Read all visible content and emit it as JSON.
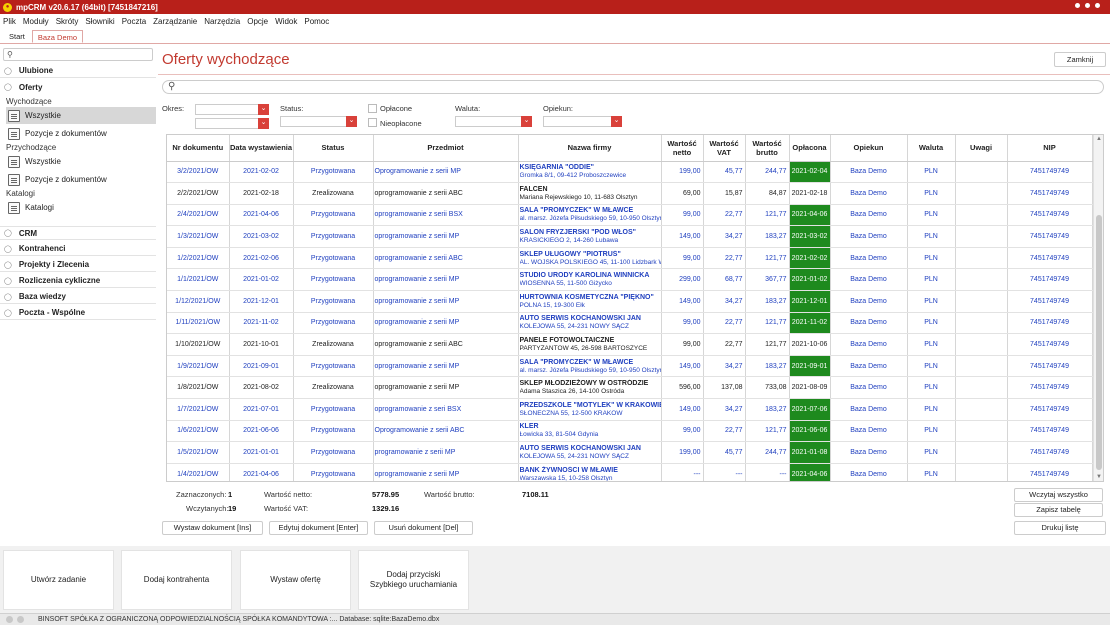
{
  "window": {
    "title": "mpCRM v20.6.17 (64bit) [7451847216]"
  },
  "menu": [
    "Plik",
    "Moduły",
    "Skróty",
    "Słowniki",
    "Poczta",
    "Zarządzanie",
    "Narzędzia",
    "Opcje",
    "Widok",
    "Pomoc"
  ],
  "tabs": [
    {
      "label": "Start"
    },
    {
      "label": "Baza Demo"
    }
  ],
  "sidebar": {
    "ulubione": "Ulubione",
    "oferty": "Oferty",
    "wychodzace": "Wychodzące",
    "wszystkie": "Wszystkie",
    "pozycje": "Pozycje z dokumentów",
    "przychodzace": "Przychodzące",
    "katalogi": "Katalogi",
    "sections": [
      "CRM",
      "Kontrahenci",
      "Projekty i Zlecenia",
      "Rozliczenia cykliczne",
      "Baza wiedzy",
      "Poczta - Wspólne"
    ]
  },
  "main": {
    "title": "Oferty wychodzące",
    "close_label": "Zamknij",
    "filters": {
      "okres": "Okres:",
      "status": "Status:",
      "oplacone": "Opłacone",
      "nieoplacone": "Nieopłacone",
      "waluta": "Waluta:",
      "opiekun": "Opiekun:"
    },
    "columns": [
      "Nr dokumentu",
      "Data wystawienia",
      "Status",
      "Przedmiot",
      "Nazwa firmy",
      "Wartość netto",
      "Wartość VAT",
      "Wartość brutto",
      "Opłacona",
      "Opiekun",
      "Waluta",
      "Uwagi",
      "NIP"
    ],
    "rows": [
      {
        "nr": "3/2/2021/OW",
        "data": "2021-02-02",
        "status": "Przygotowana",
        "przedmiot": "Oprogramowanie z serii MP",
        "firma": "KSIĘGARNIA \"ODDIE\"",
        "adres": "Gromka 8/1, 09-412 Proboszczewice",
        "netto": "199,00",
        "vat": "45,77",
        "brutto": "244,77",
        "oplacona": "2021-02-04",
        "opiekun": "Baza Demo",
        "waluta": "PLN",
        "uwagi": "",
        "nip": "7451749749"
      },
      {
        "nr": "2/2/2021/OW",
        "data": "2021-02-18",
        "status": "Zrealizowana",
        "przedmiot": "oprogramowanie z serii ABC",
        "firma": "FALCEN",
        "adres": "Mariana Rejewskiego 10, 11-683 Olsztyn",
        "netto": "69,00",
        "vat": "15,87",
        "brutto": "84,87",
        "oplacona": "2021-02-18",
        "opiekun": "Baza Demo",
        "waluta": "PLN",
        "uwagi": "",
        "nip": "7451749749"
      },
      {
        "nr": "2/4/2021/OW",
        "data": "2021-04-06",
        "status": "Przygotowana",
        "przedmiot": "oprogramowanie z serii BSX",
        "firma": "SALA \"PROMYCZEK\" W MŁAWCE",
        "adres": "al. marsz. Józefa Piłsudskiego 59, 10-950 Olsztyn",
        "netto": "99,00",
        "vat": "22,77",
        "brutto": "121,77",
        "oplacona": "2021-04-06",
        "opiekun": "Baza Demo",
        "waluta": "PLN",
        "uwagi": "",
        "nip": "7451749749"
      },
      {
        "nr": "1/3/2021/OW",
        "data": "2021-03-02",
        "status": "Przygotowana",
        "przedmiot": "oprogramowanie z serii MP",
        "firma": "SALON FRYZJERSKI \"POD WŁOS\"",
        "adres": "KRASICKIEGO 2, 14-260 Lubawa",
        "netto": "149,00",
        "vat": "34,27",
        "brutto": "183,27",
        "oplacona": "2021-03-02",
        "opiekun": "Baza Demo",
        "waluta": "PLN",
        "uwagi": "",
        "nip": "7451749749"
      },
      {
        "nr": "1/2/2021/OW",
        "data": "2021-02-06",
        "status": "Przygotowana",
        "przedmiot": "oprogramowanie z serii ABC",
        "firma": "SKLEP UŁUGOWY \"PIOTRUŚ\"",
        "adres": "AL. WOJSKA POLSKIEGO 45, 11-100 Lidzbark Warmiński",
        "netto": "99,00",
        "vat": "22,77",
        "brutto": "121,77",
        "oplacona": "2021-02-02",
        "opiekun": "Baza Demo",
        "waluta": "PLN",
        "uwagi": "",
        "nip": "7451749749"
      },
      {
        "nr": "1/1/2021/OW",
        "data": "2021-01-02",
        "status": "Przygotowana",
        "przedmiot": "oprogramowanie  z serii MP",
        "firma": "STUDIO URODY KAROLINA WINNICKA",
        "adres": "WIOSENNA 55, 11-500 Giżycko",
        "netto": "299,00",
        "vat": "68,77",
        "brutto": "367,77",
        "oplacona": "2021-01-02",
        "opiekun": "Baza Demo",
        "waluta": "PLN",
        "uwagi": "",
        "nip": "7451749749"
      },
      {
        "nr": "1/12/2021/OW",
        "data": "2021-12-01",
        "status": "Przygotowana",
        "przedmiot": "oprogramowanie z serii MP",
        "firma": "HURTOWNIA KOSMETYCZNA \"PIĘKNO\"",
        "adres": "POLNA 15, 19-300 Ełk",
        "netto": "149,00",
        "vat": "34,27",
        "brutto": "183,27",
        "oplacona": "2021-12-01",
        "opiekun": "Baza Demo",
        "waluta": "PLN",
        "uwagi": "",
        "nip": "7451749749"
      },
      {
        "nr": "1/11/2021/OW",
        "data": "2021-11-02",
        "status": "Przygotowana",
        "przedmiot": "oprogramowanie z serii MP",
        "firma": "AUTO SERWIS KOCHANOWSKI JAN",
        "adres": "KOLEJOWA 55, 24-231 NOWY SĄCZ",
        "netto": "99,00",
        "vat": "22,77",
        "brutto": "121,77",
        "oplacona": "2021-11-02",
        "opiekun": "Baza Demo",
        "waluta": "PLN",
        "uwagi": "",
        "nip": "7451749749"
      },
      {
        "nr": "1/10/2021/OW",
        "data": "2021-10-01",
        "status": "Zrealizowana",
        "przedmiot": "oprogramowanie z serii ABC",
        "firma": "PANELE FOTOWOLTAICZNE",
        "adres": "PARTYZANTÓW 45, 26-598 BARTOSZYCE",
        "netto": "99,00",
        "vat": "22,77",
        "brutto": "121,77",
        "oplacona": "2021-10-06",
        "opiekun": "Baza Demo",
        "waluta": "PLN",
        "uwagi": "",
        "nip": "7451749749"
      },
      {
        "nr": "1/9/2021/OW",
        "data": "2021-09-01",
        "status": "Przygotowana",
        "przedmiot": "oprogramowanie z serii MP",
        "firma": "SALA \"PROMYCZEK\" W MŁAWCE",
        "adres": "al. marsz. Józefa Piłsudskiego 59, 10-950 Olsztyn",
        "netto": "149,00",
        "vat": "34,27",
        "brutto": "183,27",
        "oplacona": "2021-09-01",
        "opiekun": "Baza Demo",
        "waluta": "PLN",
        "uwagi": "",
        "nip": "7451749749"
      },
      {
        "nr": "1/8/2021/OW",
        "data": "2021-08-02",
        "status": "Zrealizowana",
        "przedmiot": "oprogramowanie z serii MP",
        "firma": "SKLEP MŁODZIEŻOWY W OSTRÓDZIE",
        "adres": "Adama Staszica 26, 14-100 Ostróda",
        "netto": "596,00",
        "vat": "137,08",
        "brutto": "733,08",
        "oplacona": "2021-08-09",
        "opiekun": "Baza Demo",
        "waluta": "PLN",
        "uwagi": "",
        "nip": "7451749749"
      },
      {
        "nr": "1/7/2021/OW",
        "data": "2021-07-01",
        "status": "Przygotowana",
        "przedmiot": "oprogramowanie z seri BSX",
        "firma": "PRZEDSZKOLE \"MOTYLEK\" W KRAKOWIE",
        "adres": "SŁONECZNA 55, 12-500 KRAKÓW",
        "netto": "149,00",
        "vat": "34,27",
        "brutto": "183,27",
        "oplacona": "2021-07-06",
        "opiekun": "Baza Demo",
        "waluta": "PLN",
        "uwagi": "",
        "nip": "7451749749"
      },
      {
        "nr": "1/6/2021/OW",
        "data": "2021-06-06",
        "status": "Przygotowana",
        "przedmiot": "Oprogramowanie z serii ABC",
        "firma": "KLER",
        "adres": "Łowicka 33, 81-504 Gdynia",
        "netto": "99,00",
        "vat": "22,77",
        "brutto": "121,77",
        "oplacona": "2021-06-06",
        "opiekun": "Baza Demo",
        "waluta": "PLN",
        "uwagi": "",
        "nip": "7451749749"
      },
      {
        "nr": "1/5/2021/OW",
        "data": "2021-01-01",
        "status": "Przygotowana",
        "przedmiot": "programowanie z serii MP",
        "firma": "AUTO SERWIS KOCHANOWSKI JAN",
        "adres": "KOLEJOWA 55, 24-231 NOWY SĄCZ",
        "netto": "199,00",
        "vat": "45,77",
        "brutto": "244,77",
        "oplacona": "2021-01-08",
        "opiekun": "Baza Demo",
        "waluta": "PLN",
        "uwagi": "",
        "nip": "7451749749"
      },
      {
        "nr": "1/4/2021/OW",
        "data": "2021-04-06",
        "status": "Przygotowana",
        "przedmiot": "oprogramowanie z serii MP",
        "firma": "BANK ŻYWNOŚCI W MŁAWIE",
        "adres": "Warszawska 15, 10-258 Olsztyn",
        "netto": "---",
        "vat": "---",
        "brutto": "---",
        "oplacona": "2021-04-06",
        "opiekun": "Baza Demo",
        "waluta": "PLN",
        "uwagi": "",
        "nip": "7451749749"
      }
    ],
    "summary": {
      "zaznaczonych_label": "Zaznaczonych:",
      "zaznaczonych_value": "1",
      "wczytanych_label": "Wczytanych:",
      "wczytanych_value": "19",
      "netto_label": "Wartość netto:",
      "netto_value": "5778.95",
      "vat_label": "Wartość VAT:",
      "vat_value": "1329.16",
      "brutto_label": "Wartość brutto:",
      "brutto_value": "7108.11"
    },
    "buttons": {
      "wczytaj": "Wczytaj wszystko",
      "zapisz": "Zapisz tabelę",
      "wystaw": "Wystaw dokument [Ins]",
      "edytuj": "Edytuj dokument [Enter]",
      "usun": "Usuń dokument [Del]",
      "drukuj": "Drukuj listę"
    }
  },
  "quick_actions": [
    "Utwórz zadanie",
    "Dodaj kontrahenta",
    "Wystaw ofertę",
    "Dodaj przyciski\nSzybkiego uruchamiania"
  ],
  "statusbar": {
    "text": "BINSOFT SPÓŁKA Z OGRANICZONĄ ODPOWIEDZIALNOŚCIĄ SPÓŁKA KOMANDYTOWA :... Database: sqlite:BazaDemo.dbx"
  },
  "colors": {
    "accent": "#c23a30",
    "paid": "#1e8a1e",
    "link": "#1f3fbf",
    "titlebar": "#b8201a"
  }
}
